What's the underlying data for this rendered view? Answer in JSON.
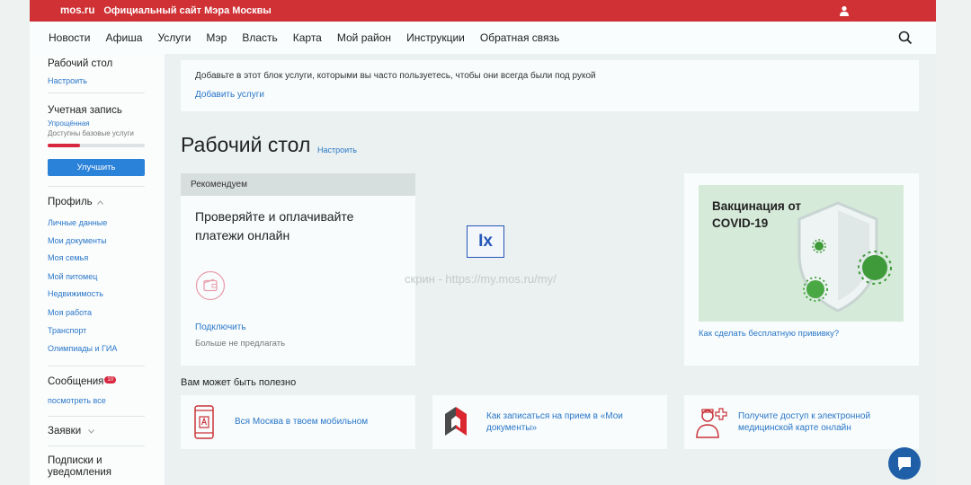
{
  "topbar": {
    "logo": "mos.ru",
    "site_title": "Официальный сайт Мэра Москвы"
  },
  "nav": {
    "items": [
      "Новости",
      "Афиша",
      "Услуги",
      "Мэр",
      "Власть",
      "Карта",
      "Мой район",
      "Инструкции",
      "Обратная связь"
    ]
  },
  "sidebar": {
    "desktop": "Рабочий стол",
    "desktop_settings": "Настроить",
    "account": "Учетная запись",
    "account_type": "Упрощённая",
    "account_note": "Доступны базовые услуги",
    "account_progress": 0.33,
    "upgrade_button": "Улучшить",
    "profile": "Профиль",
    "profile_links": [
      "Личные данные",
      "Мои документы",
      "Моя семья",
      "Мой питомец",
      "Недвижимость",
      "Моя работа",
      "Транспорт",
      "Олимпиады и ГИА"
    ],
    "messages": "Сообщения",
    "messages_count": "10",
    "messages_link": "посмотреть все",
    "requests": "Заявки",
    "subscriptions": "Подписки и уведомления"
  },
  "shortcuts": {
    "text": "Добавьте в этот блок услуги, которыми вы часто пользуетесь, чтобы они всегда были под рукой",
    "link": "Добавить услуги"
  },
  "desktop": {
    "title": "Рабочий стол",
    "settings": "Настроить"
  },
  "recommend": {
    "header": "Рекомендуем",
    "title": "Проверяйте и оплачивайте платежи онлайн",
    "connect": "Подключить",
    "dismiss": "Больше не предлагать"
  },
  "overlay": {
    "logo": "Ix",
    "watermark": "скрин - https://my.mos.ru/my/"
  },
  "vaccine": {
    "title": "Вакцинация от COVID-19",
    "link": "Как сделать бесплатную прививку?"
  },
  "useful": {
    "title": "Вам может быть полезно",
    "cards": [
      {
        "text": "Вся Москва в твоем мобильном"
      },
      {
        "text": "Как записаться на прием в «Мои документы»"
      },
      {
        "text": "Получите доступ к электронной медицинской карте онлайн"
      }
    ]
  },
  "colors": {
    "brand_red": "#cf3135",
    "link_blue": "#2a76c8",
    "button_blue": "#2b82d9"
  }
}
